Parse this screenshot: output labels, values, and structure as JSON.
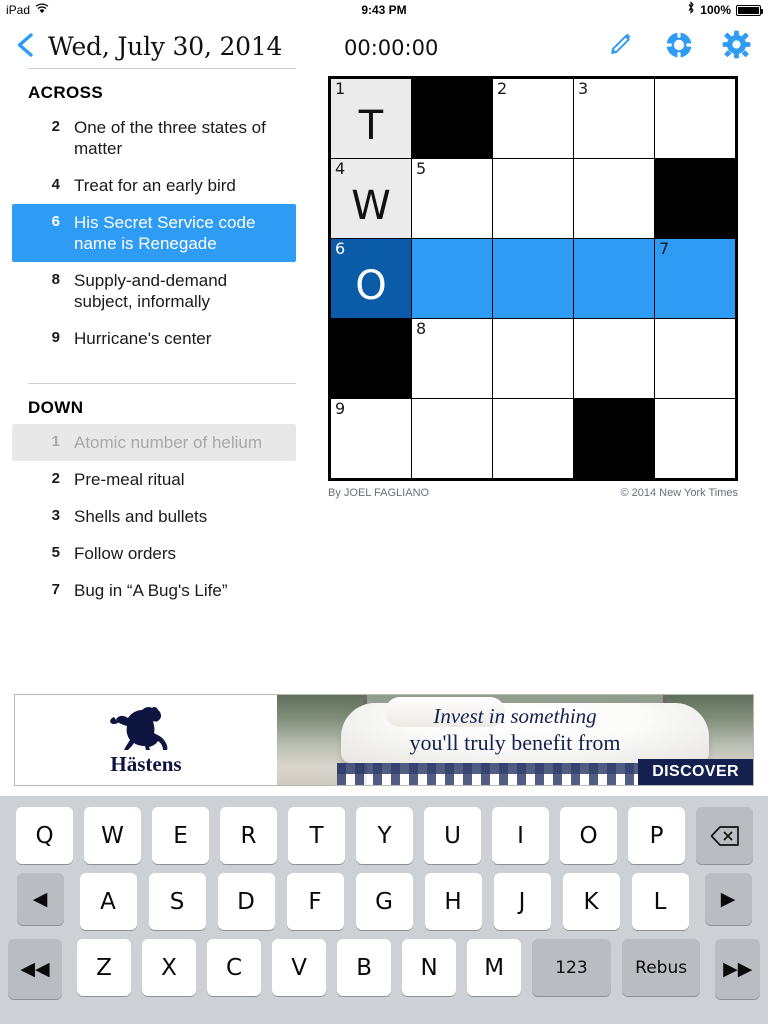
{
  "status_bar": {
    "carrier": "iPad",
    "wifi_icon": "wifi-icon",
    "time": "9:43 PM",
    "bluetooth_icon": "bluetooth-icon",
    "battery_percent": "100%",
    "battery_icon": "battery-full-icon"
  },
  "nav": {
    "back_icon": "chevron-left-icon",
    "date": "Wed, July 30, 2014",
    "timer": "00:00:00",
    "icons": [
      {
        "name": "pencil-icon",
        "label": "Notes"
      },
      {
        "name": "life-preserver-icon",
        "label": "Help"
      },
      {
        "name": "gear-icon",
        "label": "Settings"
      }
    ],
    "accent_color": "#2e9bf5"
  },
  "clues": {
    "across_heading": "ACROSS",
    "down_heading": "DOWN",
    "across": [
      {
        "number": "2",
        "text": "One of the three states of matter",
        "state": "normal"
      },
      {
        "number": "4",
        "text": "Treat for an early bird",
        "state": "normal"
      },
      {
        "number": "6",
        "text": "His Secret Service code name is Renegade",
        "state": "selected"
      },
      {
        "number": "8",
        "text": "Supply-and-demand subject, informally",
        "state": "normal"
      },
      {
        "number": "9",
        "text": "Hurricane's center",
        "state": "normal"
      }
    ],
    "down": [
      {
        "number": "1",
        "text": "Atomic number of helium",
        "state": "dim"
      },
      {
        "number": "2",
        "text": "Pre-meal ritual",
        "state": "normal"
      },
      {
        "number": "3",
        "text": "Shells and bullets",
        "state": "normal"
      },
      {
        "number": "5",
        "text": "Follow orders",
        "state": "normal"
      },
      {
        "number": "7",
        "text": "Bug in “A Bug's Life”",
        "state": "normal"
      }
    ],
    "selected_color": "#2e9bf5",
    "dim_color": "#e8e8e8"
  },
  "grid": {
    "rows": 5,
    "cols": 5,
    "active_cell_color": "#0a5ca8",
    "highlight_color": "#2e9bf5",
    "shade_color": "#ebebeb",
    "cells": [
      {
        "number": "1",
        "letter": "T",
        "state": "shade"
      },
      {
        "number": "",
        "letter": "",
        "state": "block"
      },
      {
        "number": "2",
        "letter": "",
        "state": "empty"
      },
      {
        "number": "3",
        "letter": "",
        "state": "empty"
      },
      {
        "number": "",
        "letter": "",
        "state": "empty"
      },
      {
        "number": "4",
        "letter": "W",
        "state": "shade"
      },
      {
        "number": "5",
        "letter": "",
        "state": "empty"
      },
      {
        "number": "",
        "letter": "",
        "state": "empty"
      },
      {
        "number": "",
        "letter": "",
        "state": "empty"
      },
      {
        "number": "",
        "letter": "",
        "state": "block"
      },
      {
        "number": "6",
        "letter": "O",
        "state": "active"
      },
      {
        "number": "",
        "letter": "",
        "state": "highlight"
      },
      {
        "number": "",
        "letter": "",
        "state": "highlight"
      },
      {
        "number": "",
        "letter": "",
        "state": "highlight"
      },
      {
        "number": "7",
        "letter": "",
        "state": "highlight"
      },
      {
        "number": "",
        "letter": "",
        "state": "block"
      },
      {
        "number": "8",
        "letter": "",
        "state": "empty"
      },
      {
        "number": "",
        "letter": "",
        "state": "empty"
      },
      {
        "number": "",
        "letter": "",
        "state": "empty"
      },
      {
        "number": "",
        "letter": "",
        "state": "empty"
      },
      {
        "number": "9",
        "letter": "",
        "state": "empty"
      },
      {
        "number": "",
        "letter": "",
        "state": "empty"
      },
      {
        "number": "",
        "letter": "",
        "state": "empty"
      },
      {
        "number": "",
        "letter": "",
        "state": "block"
      },
      {
        "number": "",
        "letter": "",
        "state": "empty"
      }
    ],
    "byline": "By JOEL FAGLIANO",
    "copyright": "© 2014 New York Times"
  },
  "ad": {
    "brand": "Hästens",
    "logo_icon": "horse-logo-icon",
    "headline_line1": "Invest in something",
    "headline_line2": "you'll truly benefit from",
    "cta": "DISCOVER",
    "cta_color": "#14204e"
  },
  "keyboard": {
    "row1": [
      "Q",
      "W",
      "E",
      "R",
      "T",
      "Y",
      "U",
      "I",
      "O",
      "P"
    ],
    "row2": [
      "A",
      "S",
      "D",
      "F",
      "G",
      "H",
      "J",
      "K",
      "L"
    ],
    "row3": [
      "Z",
      "X",
      "C",
      "V",
      "B",
      "N",
      "M"
    ],
    "backspace_label": "⌫",
    "backspace_name": "backspace-key",
    "prev_letter_label": "◀",
    "next_letter_label": "▶",
    "prev_word_label": "◀◀",
    "next_word_label": "▶▶",
    "numbers_label": "123",
    "rebus_label": "Rebus",
    "key_bg": "#ffffff",
    "special_key_bg": "#b9bcc1",
    "keyboard_bg": "#cdd1d6"
  }
}
